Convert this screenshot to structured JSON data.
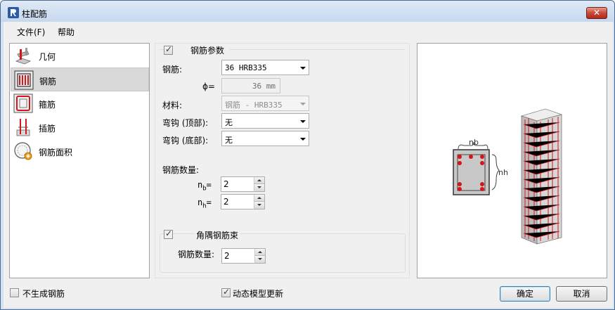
{
  "window": {
    "title": "柱配筋",
    "close_glyph": "✕"
  },
  "menu": [
    "文件(F)",
    "帮助"
  ],
  "sidebar": {
    "items": [
      {
        "label": "几何",
        "icon": "geometry-icon",
        "selected": false
      },
      {
        "label": "钢筋",
        "icon": "rebar-icon",
        "selected": true
      },
      {
        "label": "箍筋",
        "icon": "stirrup-icon",
        "selected": false
      },
      {
        "label": "插筋",
        "icon": "dowel-icon",
        "selected": false
      },
      {
        "label": "钢筋面积",
        "icon": "rebar-area-icon",
        "selected": false
      }
    ]
  },
  "rebar_params": {
    "group_title": "钢筋参数",
    "enabled": true,
    "rebar_label": "钢筋:",
    "rebar_value": "36 HRB335",
    "phi_label": "ϕ=",
    "phi_value": "36 mm",
    "material_label": "材料:",
    "material_value": "钢筋 - HRB335",
    "hook_top_label": "弯钩 (顶部):",
    "hook_top_value": "无",
    "hook_bottom_label": "弯钩 (底部):",
    "hook_bottom_value": "无",
    "count_label": "钢筋数量:",
    "nb_label": "n",
    "nb_sub": "b",
    "nb_eq": "=",
    "nb_value": "2",
    "nh_label": "n",
    "nh_sub": "h",
    "nh_eq": "=",
    "nh_value": "2"
  },
  "corner_bundle": {
    "title": "角隅钢筋束",
    "enabled": true,
    "count_label": "钢筋数量:",
    "count_value": "2"
  },
  "preview": {
    "nb_label": "nb",
    "nh_label": "nh",
    "rebar_color": "#d4161b"
  },
  "footer": {
    "no_rebar_label": "不生成钢筋",
    "no_rebar_checked": false,
    "dynamic_update_label": "动态模型更新",
    "dynamic_update_checked": true,
    "ok_label": "确定",
    "cancel_label": "取消"
  }
}
